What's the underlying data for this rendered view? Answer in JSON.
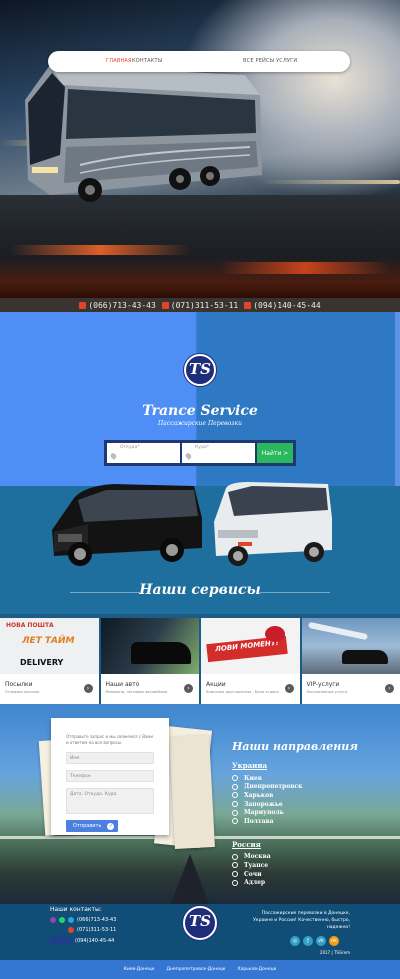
{
  "phones": [
    "(066)713-43-43",
    "(071)311-53-11",
    "(094)140-45-44"
  ],
  "nav": {
    "left": [
      "ГЛАВНАЯ",
      "КОНТАКТЫ"
    ],
    "right": [
      "ВСЕ РЕЙСЫ",
      "УСЛУГИ"
    ],
    "active": "ГЛАВНАЯ",
    "logo_text": "TS"
  },
  "brand": {
    "title": "Trance Service",
    "subtitle": "Пассажирские Перевозки"
  },
  "search": {
    "from_label": "Откуда*",
    "to_label": "Куда*",
    "button": "Найти >"
  },
  "services": {
    "title": "Наши сервисы",
    "cards": [
      {
        "title": "Посылки",
        "desc": "Отправка посылок"
      },
      {
        "title": "Наши авто",
        "desc": "Минивэны, легковые автомобили"
      },
      {
        "title": "Акции",
        "desc": "Компания двусторонняя - Была отдана"
      },
      {
        "title": "VIP-услуги",
        "desc": "Эксклюзивные услуги"
      }
    ],
    "card1_logos": [
      "НОВА ПОШТА",
      "ЛЕТ ТАЙМ",
      "DELIVERY"
    ],
    "card3_banner": "ЛОВИ МОМЕНТ!"
  },
  "contact_form": {
    "intro": "Отправьте запрос и мы свяжемся с Вами и ответим на все вопросы.",
    "name_ph": "Имя",
    "phone_ph": "Телефон",
    "msg_ph": "Дата. Откуда. Куда",
    "send": "Отправить"
  },
  "directions": {
    "title": "Наши направления",
    "ukraine_label": "Украина",
    "ukraine": [
      "Киев",
      "Днепропетровск",
      "Харьков",
      "Запорожье",
      "Мариуполь",
      "Полтава"
    ],
    "russia_label": "Россия",
    "russia": [
      "Москва",
      "Туапсе",
      "Сочи",
      "Адлер"
    ]
  },
  "footer": {
    "contacts_title": "Наши контакты:",
    "phones": [
      "(066)713-43-43",
      "(071)311-53-11",
      "(094)140-45-44"
    ],
    "about": "Пассажирские перевозки в Донецке, Украине и России! Качественно, быстро, надежно!",
    "copyright": "2017 | TSGrem",
    "social_icons": [
      "instagram-icon",
      "odnoklassniki-icon",
      "vk-icon",
      "ok-icon"
    ],
    "bottom_links": [
      "Киев-Донецк",
      "Днепропетровск-Донецк",
      "Харьков-Донецк"
    ]
  },
  "colors": {
    "accent": "#e0452b",
    "primary": "#3a7be0",
    "green": "#2bb760",
    "footer": "#104e77"
  }
}
